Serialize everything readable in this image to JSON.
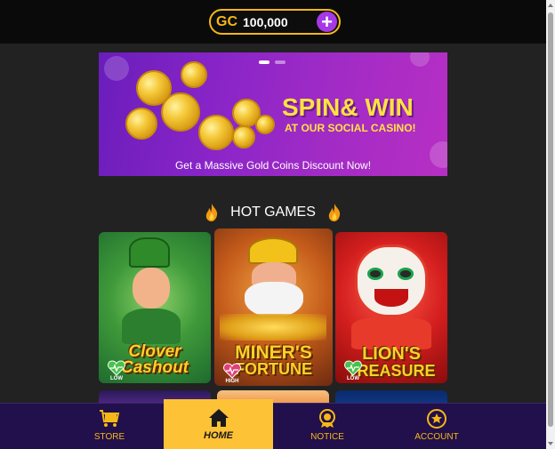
{
  "header": {
    "currency_label": "GC",
    "balance": "100,000",
    "add_symbol": "+"
  },
  "banner": {
    "title": "SPIN& WIN",
    "subtitle": "AT OUR SOCIAL CASINO!",
    "footer": "Get a Massive Gold Coins Discount Now!",
    "slides_total": 2,
    "slide_active": 1
  },
  "hot_games": {
    "title": "HOT GAMES",
    "icon": "fire-icon",
    "games": [
      {
        "name_line1": "Clover",
        "name_line2": "Cashout",
        "volatility": "LOW"
      },
      {
        "name_line1": "MINER'S",
        "name_line2": "FORTUNE",
        "volatility": "HIGH"
      },
      {
        "name_line1": "LION'S",
        "name_line2": "TREASURE",
        "volatility": "LOW"
      }
    ]
  },
  "nav": {
    "items": [
      {
        "label": "STORE",
        "icon": "cart-icon"
      },
      {
        "label": "HOME",
        "icon": "home-icon",
        "active": true
      },
      {
        "label": "NOTICE",
        "icon": "notice-icon"
      },
      {
        "label": "ACCOUNT",
        "icon": "account-icon"
      }
    ]
  },
  "colors": {
    "accent": "#f6b817",
    "nav_bg": "#21104b",
    "home_active": "#fdc236",
    "plus": "#a638e6"
  }
}
